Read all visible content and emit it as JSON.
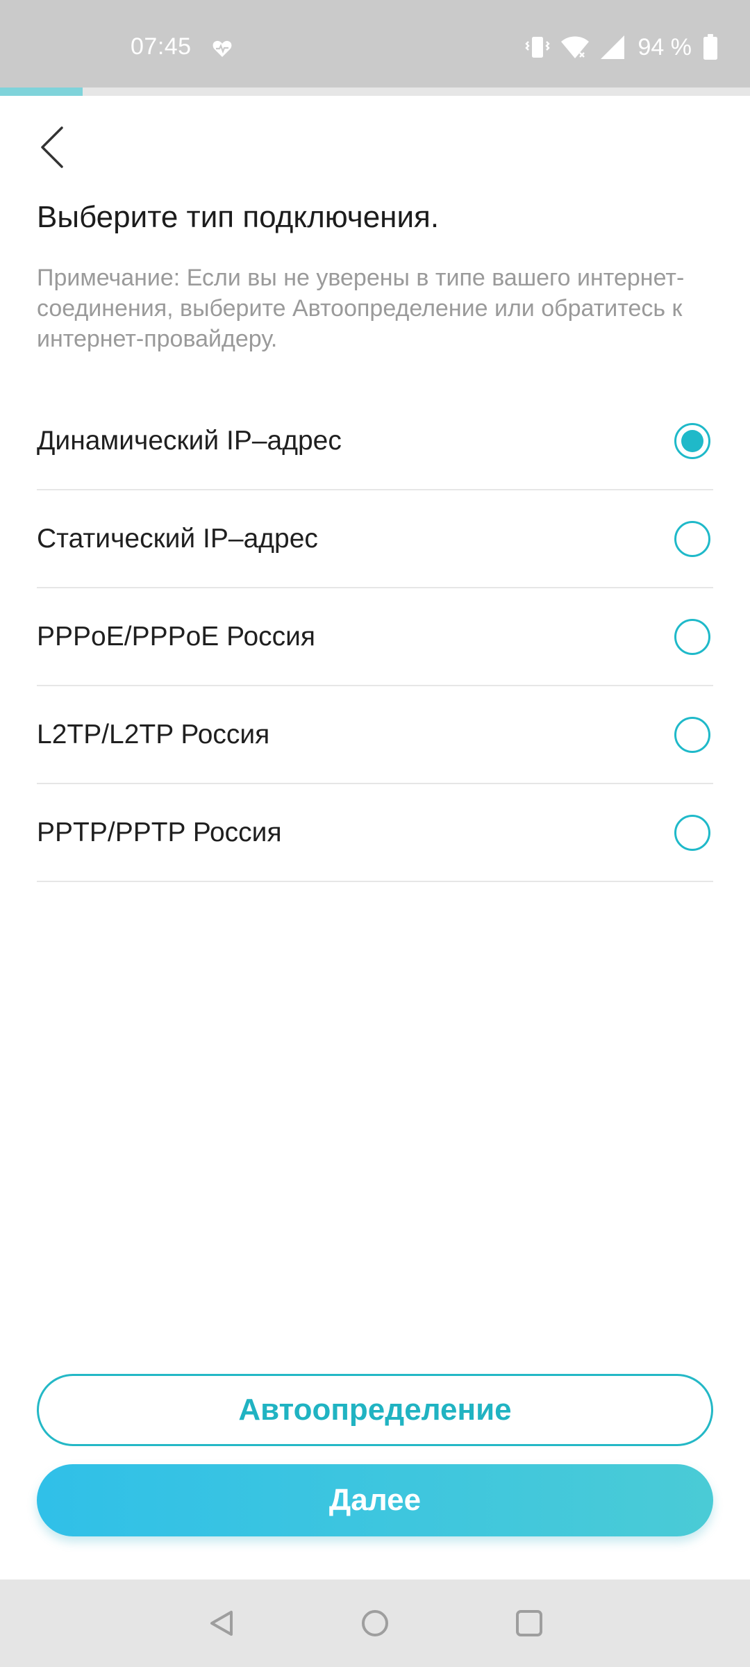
{
  "status_bar": {
    "time": "07:45",
    "battery_percent": "94 %",
    "icons": [
      "heart-pulse-icon",
      "vibrate-icon",
      "wifi-icon",
      "signal-icon",
      "battery-icon"
    ]
  },
  "progress": {
    "fraction": 0.11,
    "color": "#7fd3da"
  },
  "header": {
    "back_icon": "chevron-left-icon"
  },
  "page": {
    "title": "Выберите тип подключения.",
    "note": "Примечание: Если вы не уверены в типе вашего интернет-соединения, выберите Автоопределение или обратитесь к интернет-провайдеру."
  },
  "options": [
    {
      "label": "Динамический IP–адрес",
      "selected": true
    },
    {
      "label": "Статический IP–адрес",
      "selected": false
    },
    {
      "label": "PPPoE/PPPoE Россия",
      "selected": false
    },
    {
      "label": "L2TP/L2TP Россия",
      "selected": false
    },
    {
      "label": "PPTP/PPTP Россия",
      "selected": false
    }
  ],
  "buttons": {
    "auto_detect": "Автоопределение",
    "next": "Далее"
  },
  "colors": {
    "accent": "#1fb9c9",
    "status_bar_bg": "#cacaca",
    "nav_bar_bg": "#e5e5e5"
  },
  "nav_bar": {
    "icons": [
      "back-triangle-icon",
      "home-circle-icon",
      "recents-square-icon"
    ]
  }
}
